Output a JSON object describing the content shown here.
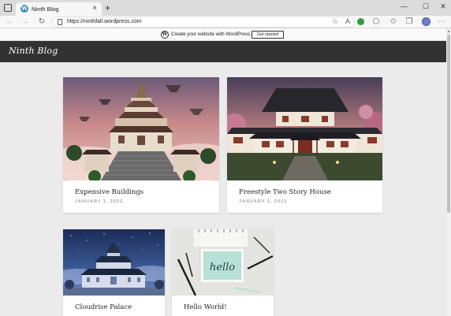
{
  "browser": {
    "tab_title": "Ninth Blog",
    "tab_favicon": "W",
    "url": "https://ninthfall.wordpress.com",
    "icons": [
      "tab-actions-icon",
      "back-icon",
      "forward-icon",
      "refresh-icon",
      "lock-icon",
      "favorite-star-icon",
      "read-aloud-icon",
      "extension-icon",
      "favorites-icon",
      "collections-icon",
      "profile-icon",
      "more-icon"
    ]
  },
  "wp_banner": {
    "text": "Create your website with WordPress.com",
    "button": "Get started"
  },
  "site": {
    "title": "Ninth Blog"
  },
  "posts": [
    {
      "title": "Expensive Buildings",
      "date": "JANUARY 3, 2022"
    },
    {
      "title": "Freestyle Two Story House",
      "date": "JANUARY 3, 2022"
    },
    {
      "title": "Cloudrise Palace",
      "date": ""
    },
    {
      "title": "Hello World!",
      "date": ""
    }
  ],
  "thumb_texts": {
    "hello": "hello"
  },
  "colors": {
    "header_bg": "#323232",
    "page_bg": "#ebebeb",
    "date_color": "#a0a0a0"
  }
}
